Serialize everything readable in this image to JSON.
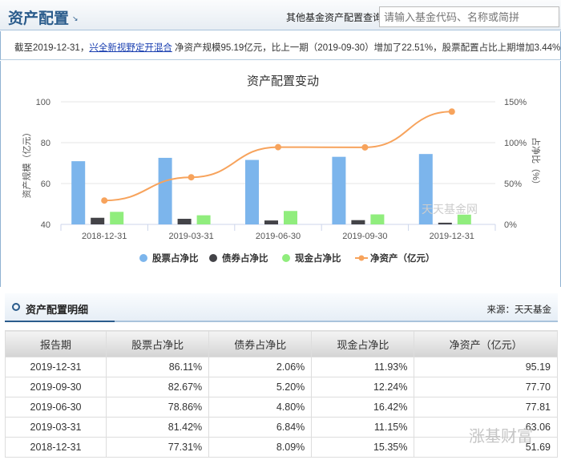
{
  "header": {
    "title": "资产配置",
    "query_label": "其他基金资产配置查询:",
    "search_placeholder": "请输入基金代码、名称或简拼"
  },
  "info": {
    "prefix": "截至2019-12-31，",
    "fund_name": "兴全新视野定开混合",
    "suffix": " 净资产规模95.19亿元，比上一期（2019-09-30）增加了22.51%，股票配置占比上期增加3.44%"
  },
  "chart_data": {
    "type": "bar",
    "title": "资产配置变动",
    "categories": [
      "2018-12-31",
      "2019-03-31",
      "2019-06-30",
      "2019-09-30",
      "2019-12-31"
    ],
    "ylabel": "资产规模（亿元）",
    "ylim": [
      40,
      100
    ],
    "yticks": [
      "100",
      "80",
      "60",
      "40"
    ],
    "y2label": "占净比（%）",
    "y2lim": [
      0,
      150
    ],
    "y2ticks": [
      "150%",
      "100%",
      "50%",
      "0%"
    ],
    "series": [
      {
        "name": "股票占净比",
        "type": "bar",
        "axis": "right",
        "color": "#7cb5ec",
        "values": [
          77.31,
          81.42,
          78.86,
          82.67,
          86.11
        ]
      },
      {
        "name": "债券占净比",
        "type": "bar",
        "axis": "right",
        "color": "#434348",
        "values": [
          8.09,
          6.84,
          4.8,
          5.2,
          2.06
        ]
      },
      {
        "name": "现金占净比",
        "type": "bar",
        "axis": "right",
        "color": "#90ed7d",
        "values": [
          15.35,
          11.15,
          16.42,
          12.24,
          11.93
        ]
      },
      {
        "name": "净资产（亿元）",
        "type": "line",
        "axis": "left",
        "color": "#f7a35c",
        "values": [
          51.69,
          63.06,
          77.81,
          77.7,
          95.19
        ]
      }
    ],
    "watermark": "天天基金网",
    "legend_position": "bottom"
  },
  "detail": {
    "title": "资产配置明细",
    "source": "来源：天天基金",
    "columns": [
      "报告期",
      "股票占净比",
      "债券占净比",
      "现金占净比",
      "净资产（亿元）"
    ],
    "rows": [
      [
        "2019-12-31",
        "86.11%",
        "2.06%",
        "11.93%",
        "95.19"
      ],
      [
        "2019-09-30",
        "82.67%",
        "5.20%",
        "12.24%",
        "77.70"
      ],
      [
        "2019-06-30",
        "78.86%",
        "4.80%",
        "16.42%",
        "77.81"
      ],
      [
        "2019-03-31",
        "81.42%",
        "6.84%",
        "11.15%",
        "63.06"
      ],
      [
        "2018-12-31",
        "77.31%",
        "8.09%",
        "15.35%",
        "51.69"
      ]
    ]
  },
  "watermark": "涨基财富"
}
